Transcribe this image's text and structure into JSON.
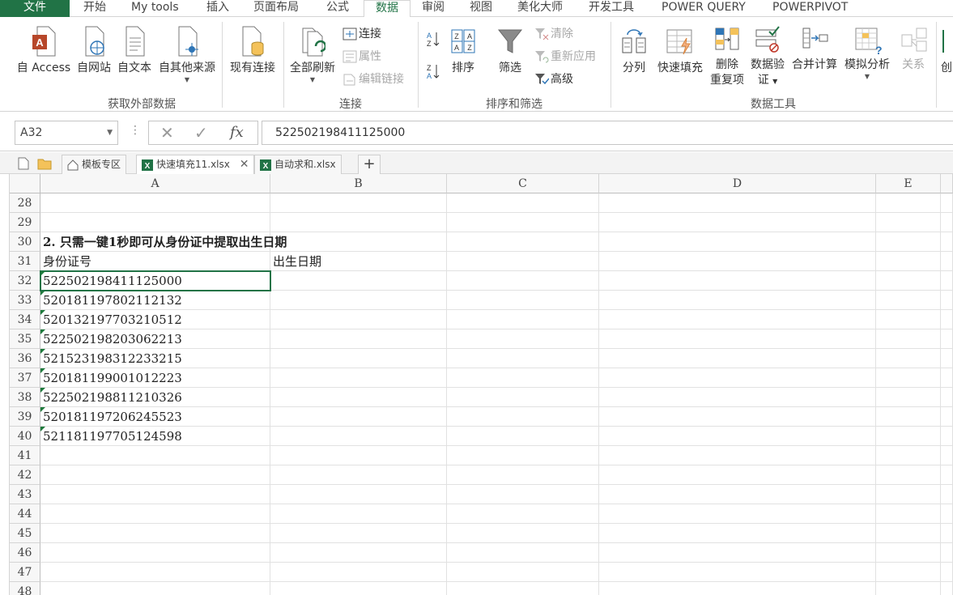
{
  "ribbon_tabs": [
    {
      "label": "文件"
    },
    {
      "label": "开始"
    },
    {
      "label": "My tools"
    },
    {
      "label": "插入"
    },
    {
      "label": "页面布局"
    },
    {
      "label": "公式"
    },
    {
      "label": "数据"
    },
    {
      "label": "审阅"
    },
    {
      "label": "视图"
    },
    {
      "label": "美化大师"
    },
    {
      "label": "开发工具"
    },
    {
      "label": "POWER QUERY"
    },
    {
      "label": "POWERPIVOT"
    }
  ],
  "active_tab": "数据",
  "groups": {
    "external": {
      "label": "获取外部数据",
      "access": "自 Access",
      "web": "自网站",
      "text": "自文本",
      "other": "自其他来源",
      "existing": "现有连接"
    },
    "connections": {
      "label": "连接",
      "refresh_all": "全部刷新",
      "connections": "连接",
      "properties": "属性",
      "edit_links": "编辑链接"
    },
    "sort_filter": {
      "label": "排序和筛选",
      "sort": "排序",
      "filter": "筛选",
      "clear": "清除",
      "reapply": "重新应用",
      "advanced": "高级"
    },
    "data_tools": {
      "label": "数据工具",
      "text_to_columns": "分列",
      "flash_fill": "快速填充",
      "remove_dup_1": "删除",
      "remove_dup_2": "重复项",
      "validation_1": "数据验",
      "validation_2": "证",
      "consolidate": "合并计算",
      "what_if": "模拟分析",
      "relationships": "关系",
      "create": "创"
    }
  },
  "formula_bar": {
    "name_box": "A32",
    "fx": "fx",
    "value": "522502198411125000"
  },
  "doc_tabs": {
    "templates": "模板专区",
    "file1": "快速填充11.xlsx",
    "file2": "自动求和.xlsx",
    "add": "+"
  },
  "columns": [
    "A",
    "B",
    "C",
    "D",
    "E"
  ],
  "rows": [
    {
      "num": "28",
      "a": "",
      "b": ""
    },
    {
      "num": "29",
      "a": "",
      "b": ""
    },
    {
      "num": "30",
      "a": "2. 只需一键1秒即可从身份证中提取出生日期",
      "b": "",
      "bold": true
    },
    {
      "num": "31",
      "a": "身份证号",
      "b": "出生日期"
    },
    {
      "num": "32",
      "a": "522502198411125000",
      "b": "",
      "tri": true
    },
    {
      "num": "33",
      "a": "520181197802112132",
      "b": "",
      "tri": true
    },
    {
      "num": "34",
      "a": "520132197703210512",
      "b": "",
      "tri": true
    },
    {
      "num": "35",
      "a": "522502198203062213",
      "b": "",
      "tri": true
    },
    {
      "num": "36",
      "a": "521523198312233215",
      "b": "",
      "tri": true
    },
    {
      "num": "37",
      "a": "520181199001012223",
      "b": "",
      "tri": true
    },
    {
      "num": "38",
      "a": "522502198811210326",
      "b": "",
      "tri": true
    },
    {
      "num": "39",
      "a": "520181197206245523",
      "b": "",
      "tri": true
    },
    {
      "num": "40",
      "a": "521181197705124598",
      "b": "",
      "tri": true
    },
    {
      "num": "41",
      "a": "",
      "b": ""
    },
    {
      "num": "42",
      "a": "",
      "b": ""
    },
    {
      "num": "43",
      "a": "",
      "b": ""
    },
    {
      "num": "44",
      "a": "",
      "b": ""
    },
    {
      "num": "45",
      "a": "",
      "b": ""
    },
    {
      "num": "46",
      "a": "",
      "b": ""
    },
    {
      "num": "47",
      "a": "",
      "b": ""
    },
    {
      "num": "48",
      "a": "",
      "b": ""
    }
  ],
  "colors": {
    "accent": "#217346",
    "number_triangle": "#1e7a3c"
  }
}
